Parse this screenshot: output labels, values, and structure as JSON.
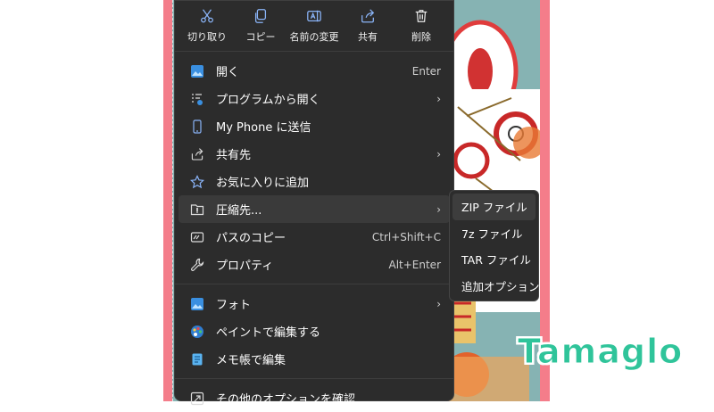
{
  "quick_actions": [
    {
      "label": "切り取り",
      "icon": "scissors-icon"
    },
    {
      "label": "コピー",
      "icon": "copy-icon"
    },
    {
      "label": "名前の変更",
      "icon": "rename-icon"
    },
    {
      "label": "共有",
      "icon": "share-icon"
    },
    {
      "label": "削除",
      "icon": "trash-icon"
    }
  ],
  "menu": {
    "open": {
      "label": "開く",
      "shortcut": "Enter",
      "icon": "photos-icon"
    },
    "open_with": {
      "label": "プログラムから開く",
      "icon": "apps-icon"
    },
    "send_phone": {
      "label": "My Phone に送信",
      "icon": "phone-icon"
    },
    "share_to": {
      "label": "共有先",
      "icon": "share-icon"
    },
    "favorite": {
      "label": "お気に入りに追加",
      "icon": "star-icon"
    },
    "compress": {
      "label": "圧縮先...",
      "icon": "archive-icon"
    },
    "copy_path": {
      "label": "パスのコピー",
      "shortcut": "Ctrl+Shift+C",
      "icon": "path-icon"
    },
    "properties": {
      "label": "プロパティ",
      "shortcut": "Alt+Enter",
      "icon": "wrench-icon"
    },
    "photos": {
      "label": "フォト",
      "icon": "photos-icon"
    },
    "paint": {
      "label": "ペイントで編集する",
      "icon": "paint-icon"
    },
    "notepad": {
      "label": "メモ帳で編集",
      "icon": "notepad-icon"
    },
    "more": {
      "label": "その他のオプションを確認",
      "icon": "more-options-icon"
    }
  },
  "submenu": [
    "ZIP ファイル",
    "7z ファイル",
    "TAR ファイル",
    "追加オプション"
  ],
  "watermark": "Tamaglo",
  "colors": {
    "menu_bg": "#2c2c2c",
    "accent": "#2fc49a",
    "border_pink": "#f47d8a",
    "teal_bg": "#86b3b3"
  }
}
